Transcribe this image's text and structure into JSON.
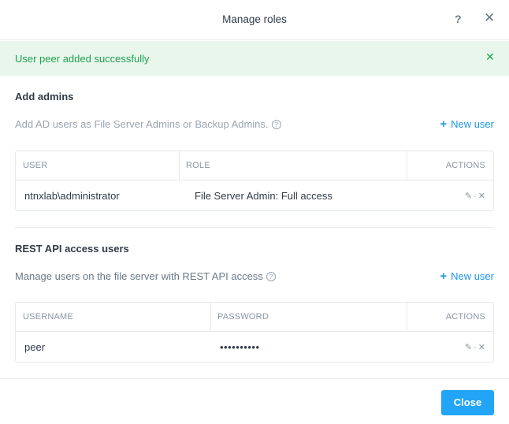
{
  "dialog": {
    "title": "Manage roles",
    "help_label": "?",
    "close_glyph": "✕"
  },
  "banner": {
    "message": "User peer added successfully",
    "dismiss_glyph": "✕",
    "color": "#22a052"
  },
  "admins": {
    "title": "Add admins",
    "description": "Add AD users as File Server Admins or Backup Admins.",
    "new_user_label": "New user",
    "columns": [
      "USER",
      "ROLE",
      "ACTIONS"
    ],
    "rows": [
      {
        "user": "ntnxlab\\administrator",
        "role": "File Server Admin: Full access"
      }
    ]
  },
  "rest_api": {
    "title": "REST API access users",
    "description": "Manage users on the file server with REST API access",
    "new_user_label": "New user",
    "columns": [
      "USERNAME",
      "PASSWORD",
      "ACTIONS"
    ],
    "rows": [
      {
        "username": "peer",
        "password": "••••••••••"
      }
    ]
  },
  "footer": {
    "close_label": "Close",
    "accent": "#22a5f7"
  }
}
